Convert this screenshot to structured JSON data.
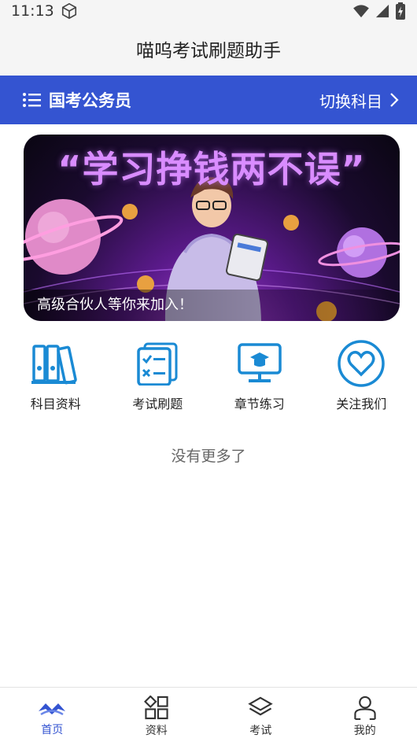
{
  "status": {
    "time": "11:13"
  },
  "app": {
    "title": "喵呜考试刷题助手"
  },
  "subject": {
    "name": "国考公务员",
    "switch_label": "切换科目"
  },
  "banner": {
    "headline": "“学习挣钱两不误”",
    "caption": "高级合伙人等你来加入！"
  },
  "menu": [
    {
      "label": "科目资料",
      "icon": "books-icon"
    },
    {
      "label": "考试刷题",
      "icon": "checklist-icon"
    },
    {
      "label": "章节练习",
      "icon": "monitor-graduation-icon"
    },
    {
      "label": "关注我们",
      "icon": "heart-icon"
    }
  ],
  "list": {
    "end_text": "没有更多了"
  },
  "tabs": [
    {
      "label": "首页",
      "icon": "home-mountain-icon",
      "active": true
    },
    {
      "label": "资料",
      "icon": "grid-icon",
      "active": false
    },
    {
      "label": "考试",
      "icon": "layers-icon",
      "active": false
    },
    {
      "label": "我的",
      "icon": "user-icon",
      "active": false
    }
  ],
  "colors": {
    "primary": "#3454d1",
    "icon_blue": "#1a8ad4",
    "background": "#f5f5f5"
  }
}
